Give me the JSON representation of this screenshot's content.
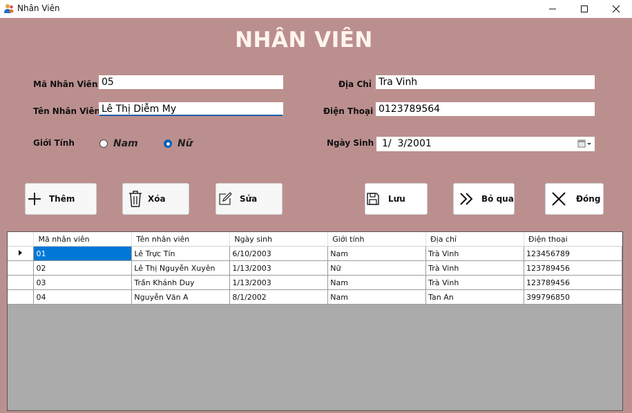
{
  "window": {
    "title": "Nhân Viên",
    "icons": [
      "app-user-icon",
      "minimize-icon",
      "maximize-icon",
      "close-icon"
    ]
  },
  "form": {
    "heading": "NHÂN VIÊN",
    "ma_nv": {
      "label": "Mã Nhân Viên",
      "value": "05"
    },
    "ten_nv": {
      "label": "Tên Nhân Viên",
      "value": "Lê Thị Diễm My"
    },
    "gioi_tinh": {
      "label": "Giới Tính",
      "options": [
        "Nam",
        "Nữ"
      ],
      "selected": "Nữ"
    },
    "dia_chi": {
      "label": "Địa Chỉ",
      "value": "Tra Vinh"
    },
    "dien_thoai": {
      "label": "Điện Thoại",
      "value": "0123789564"
    },
    "ngay_sinh": {
      "label": "Ngày Sinh",
      "value": "1/  3/2001"
    }
  },
  "buttons": {
    "them": {
      "label": "Thêm",
      "icon": "plus-icon"
    },
    "xoa": {
      "label": "Xóa",
      "icon": "trash-icon"
    },
    "sua": {
      "label": "Sửa",
      "icon": "edit-icon"
    },
    "luu": {
      "label": "Lưu",
      "icon": "save-icon"
    },
    "bo_qua": {
      "label": "Bỏ qua",
      "icon": "skip-icon"
    },
    "dong": {
      "label": "Đóng",
      "icon": "close-x-icon"
    }
  },
  "table": {
    "columns": [
      "Mã nhân viên",
      "Tên nhân viên",
      "Ngày sinh",
      "Giới tính",
      "Địa chỉ",
      "Điện thoại"
    ],
    "rows": [
      [
        "01",
        "Lê Trực Tín",
        "6/10/2003",
        "Nam",
        "Trà Vinh",
        "123456789"
      ],
      [
        "02",
        "Lê Thị Nguyễn Xuyên",
        "1/13/2003",
        "Nữ",
        "Trà Vinh",
        "123789456"
      ],
      [
        "03",
        "Trần Khánh Duy",
        "1/13/2003",
        "Nam",
        "Trà Vinh",
        "123789456"
      ],
      [
        "04",
        "Nguyễn Văn A",
        "8/1/2002",
        "Nam",
        "Tan An",
        "399796850"
      ]
    ],
    "current_row": 0
  },
  "colors": {
    "form_background": "#bc8f8f",
    "heading": "#fff5ee",
    "selection": "#0078d7",
    "grid_background": "#ababab"
  }
}
